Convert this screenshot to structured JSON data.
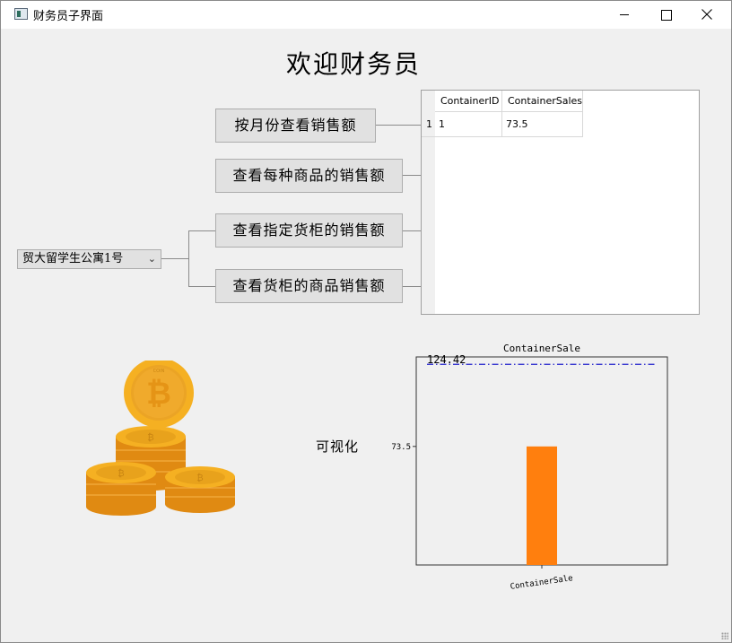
{
  "window": {
    "title": "财务员子界面"
  },
  "welcome_text": "欢迎财务员",
  "buttons": {
    "by_month": "按月份查看销售额",
    "per_product": "查看每种商品的销售额",
    "specified_container": "查看指定货柜的销售额",
    "container_products": "查看货柜的商品销售额"
  },
  "combo": {
    "selected": "贸大留学生公寓1号"
  },
  "table": {
    "columns": [
      "ContainerID",
      "ContainerSales"
    ],
    "row_headers": [
      "1"
    ],
    "rows": [
      [
        "1",
        "73.5"
      ]
    ]
  },
  "visualize_label": "可视化",
  "colors": {
    "bar": "#ff7f0e",
    "refline": "#1f1fcc",
    "coin": "#f5b022"
  },
  "chart_data": {
    "type": "bar",
    "title": "ContainerSale",
    "categories": [
      "ContainerSale"
    ],
    "values": [
      73.5
    ],
    "yticks": [
      73.5
    ],
    "reference_line": {
      "value": 124.42,
      "label": "124.42",
      "style": "dash-dot"
    },
    "ylim": [
      0,
      129
    ],
    "grid": false
  },
  "icons": {
    "app": "window-app-icon",
    "coins": "bitcoin-coins-illustration"
  }
}
